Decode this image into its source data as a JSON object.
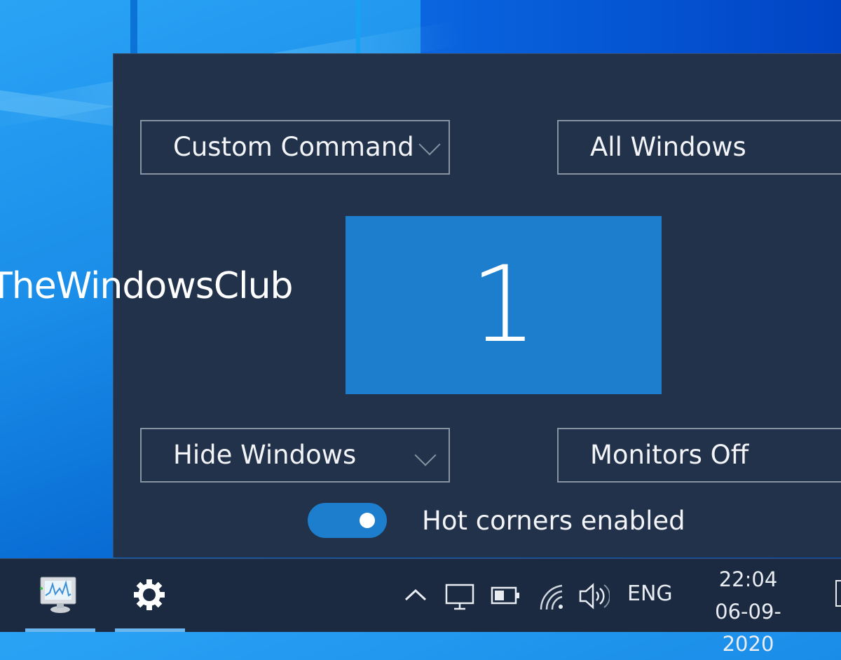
{
  "desktop": {
    "watermark": "TheWindowsClub"
  },
  "hot_corners_panel": {
    "corners": {
      "top_left": {
        "value": "Custom Command"
      },
      "top_right": {
        "value": "All Windows"
      },
      "bottom_left": {
        "value": "Hide Windows"
      },
      "bottom_right": {
        "value": "Monitors Off"
      }
    },
    "monitor_label": "1",
    "toggle": {
      "label": "Hot corners enabled",
      "on": true
    },
    "colors": {
      "panel_bg": "#22324a",
      "accent": "#1c7ecd"
    }
  },
  "taskbar": {
    "pinned": [
      {
        "name": "Performance Monitor",
        "icon": "performance-monitor-icon"
      },
      {
        "name": "Settings",
        "icon": "gear-icon"
      }
    ],
    "tray": {
      "overflow_icon": "chevron-up-icon",
      "icons": [
        "display-icon",
        "battery-icon",
        "wifi-icon",
        "volume-icon"
      ],
      "language": "ENG",
      "time": "22:04",
      "date": "06-09-2020"
    }
  }
}
